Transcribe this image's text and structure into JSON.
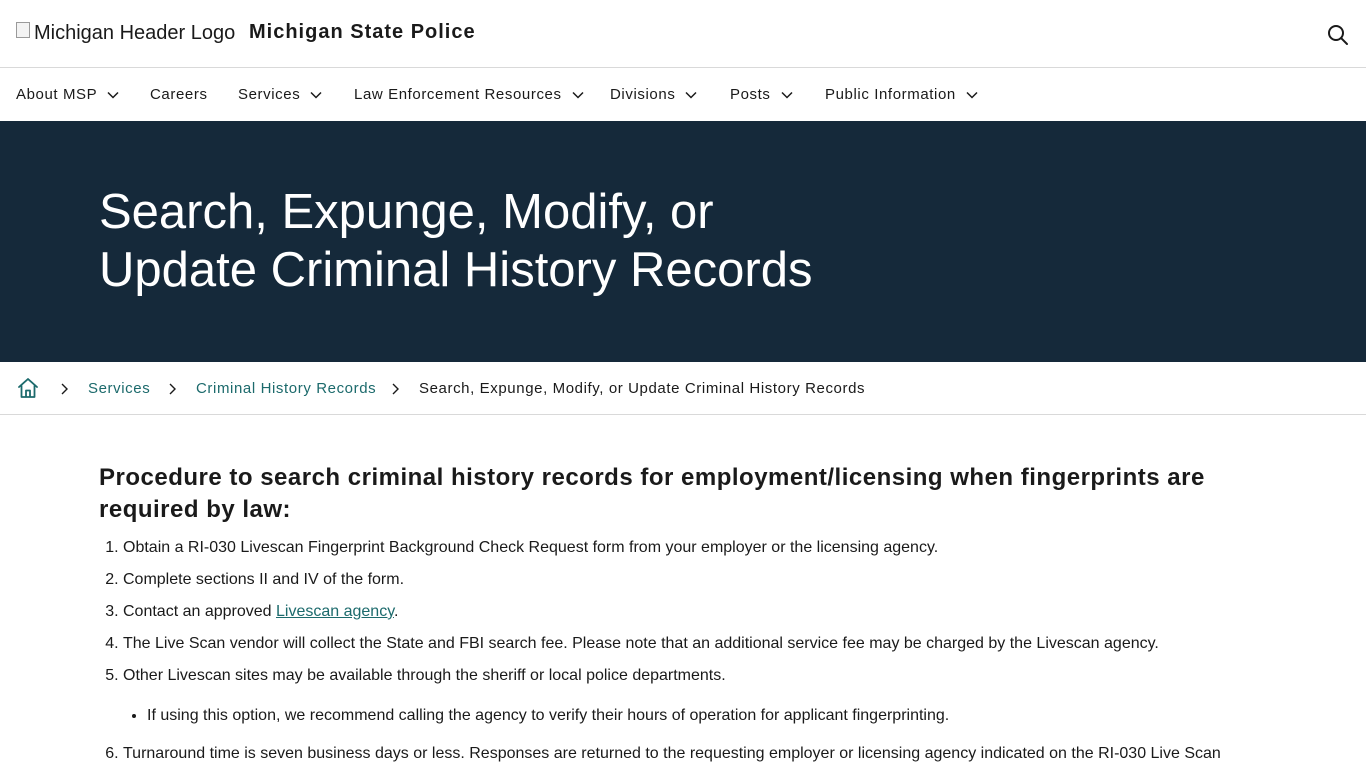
{
  "header": {
    "logo_alt": "Michigan Header Logo",
    "site_title": "Michigan State Police",
    "search_icon": "search-icon"
  },
  "nav": {
    "items": [
      {
        "label": "About MSP",
        "has_dropdown": true
      },
      {
        "label": "Careers",
        "has_dropdown": false
      },
      {
        "label": "Services",
        "has_dropdown": true
      },
      {
        "label": "Law Enforcement Resources",
        "has_dropdown": true
      },
      {
        "label": "Divisions",
        "has_dropdown": true
      },
      {
        "label": "Posts",
        "has_dropdown": true
      },
      {
        "label": "Public Information",
        "has_dropdown": true
      }
    ]
  },
  "hero": {
    "title_line1": "Search, Expunge, Modify, or",
    "title_line2": "Update Criminal History Records",
    "background": "#15293a"
  },
  "breadcrumb": {
    "home_icon": "home-icon",
    "items": [
      {
        "label": "Services"
      },
      {
        "label": "Criminal History Records"
      },
      {
        "label": "Search, Expunge, Modify, or Update Criminal History Records"
      }
    ]
  },
  "main": {
    "heading": "Procedure to search criminal history records for employment/licensing when fingerprints are required by law:",
    "steps": [
      {
        "text": "Obtain a RI-030 Livescan Fingerprint Background Check Request form from your employer or the licensing agency."
      },
      {
        "text": "Complete sections II and IV of the form."
      },
      {
        "prefix": "Contact an approved ",
        "link": "Livescan agency",
        "suffix": "."
      },
      {
        "text": "The Live Scan vendor will collect the State and FBI search fee. Please note that an additional service fee may be charged by the Livescan agency."
      },
      {
        "text": "Other Livescan sites may be available through the sheriff or local police departments.",
        "sub": [
          "If using this option, we recommend calling the agency to verify their hours of operation for applicant fingerprinting."
        ]
      },
      {
        "text": "Turnaround time is seven business days or less. Responses are returned to the requesting employer or licensing agency indicated on the RI-030 Live Scan"
      }
    ]
  },
  "colors": {
    "link": "#1c6a6c",
    "text": "#1a1a1a",
    "hero_bg": "#15293a"
  }
}
